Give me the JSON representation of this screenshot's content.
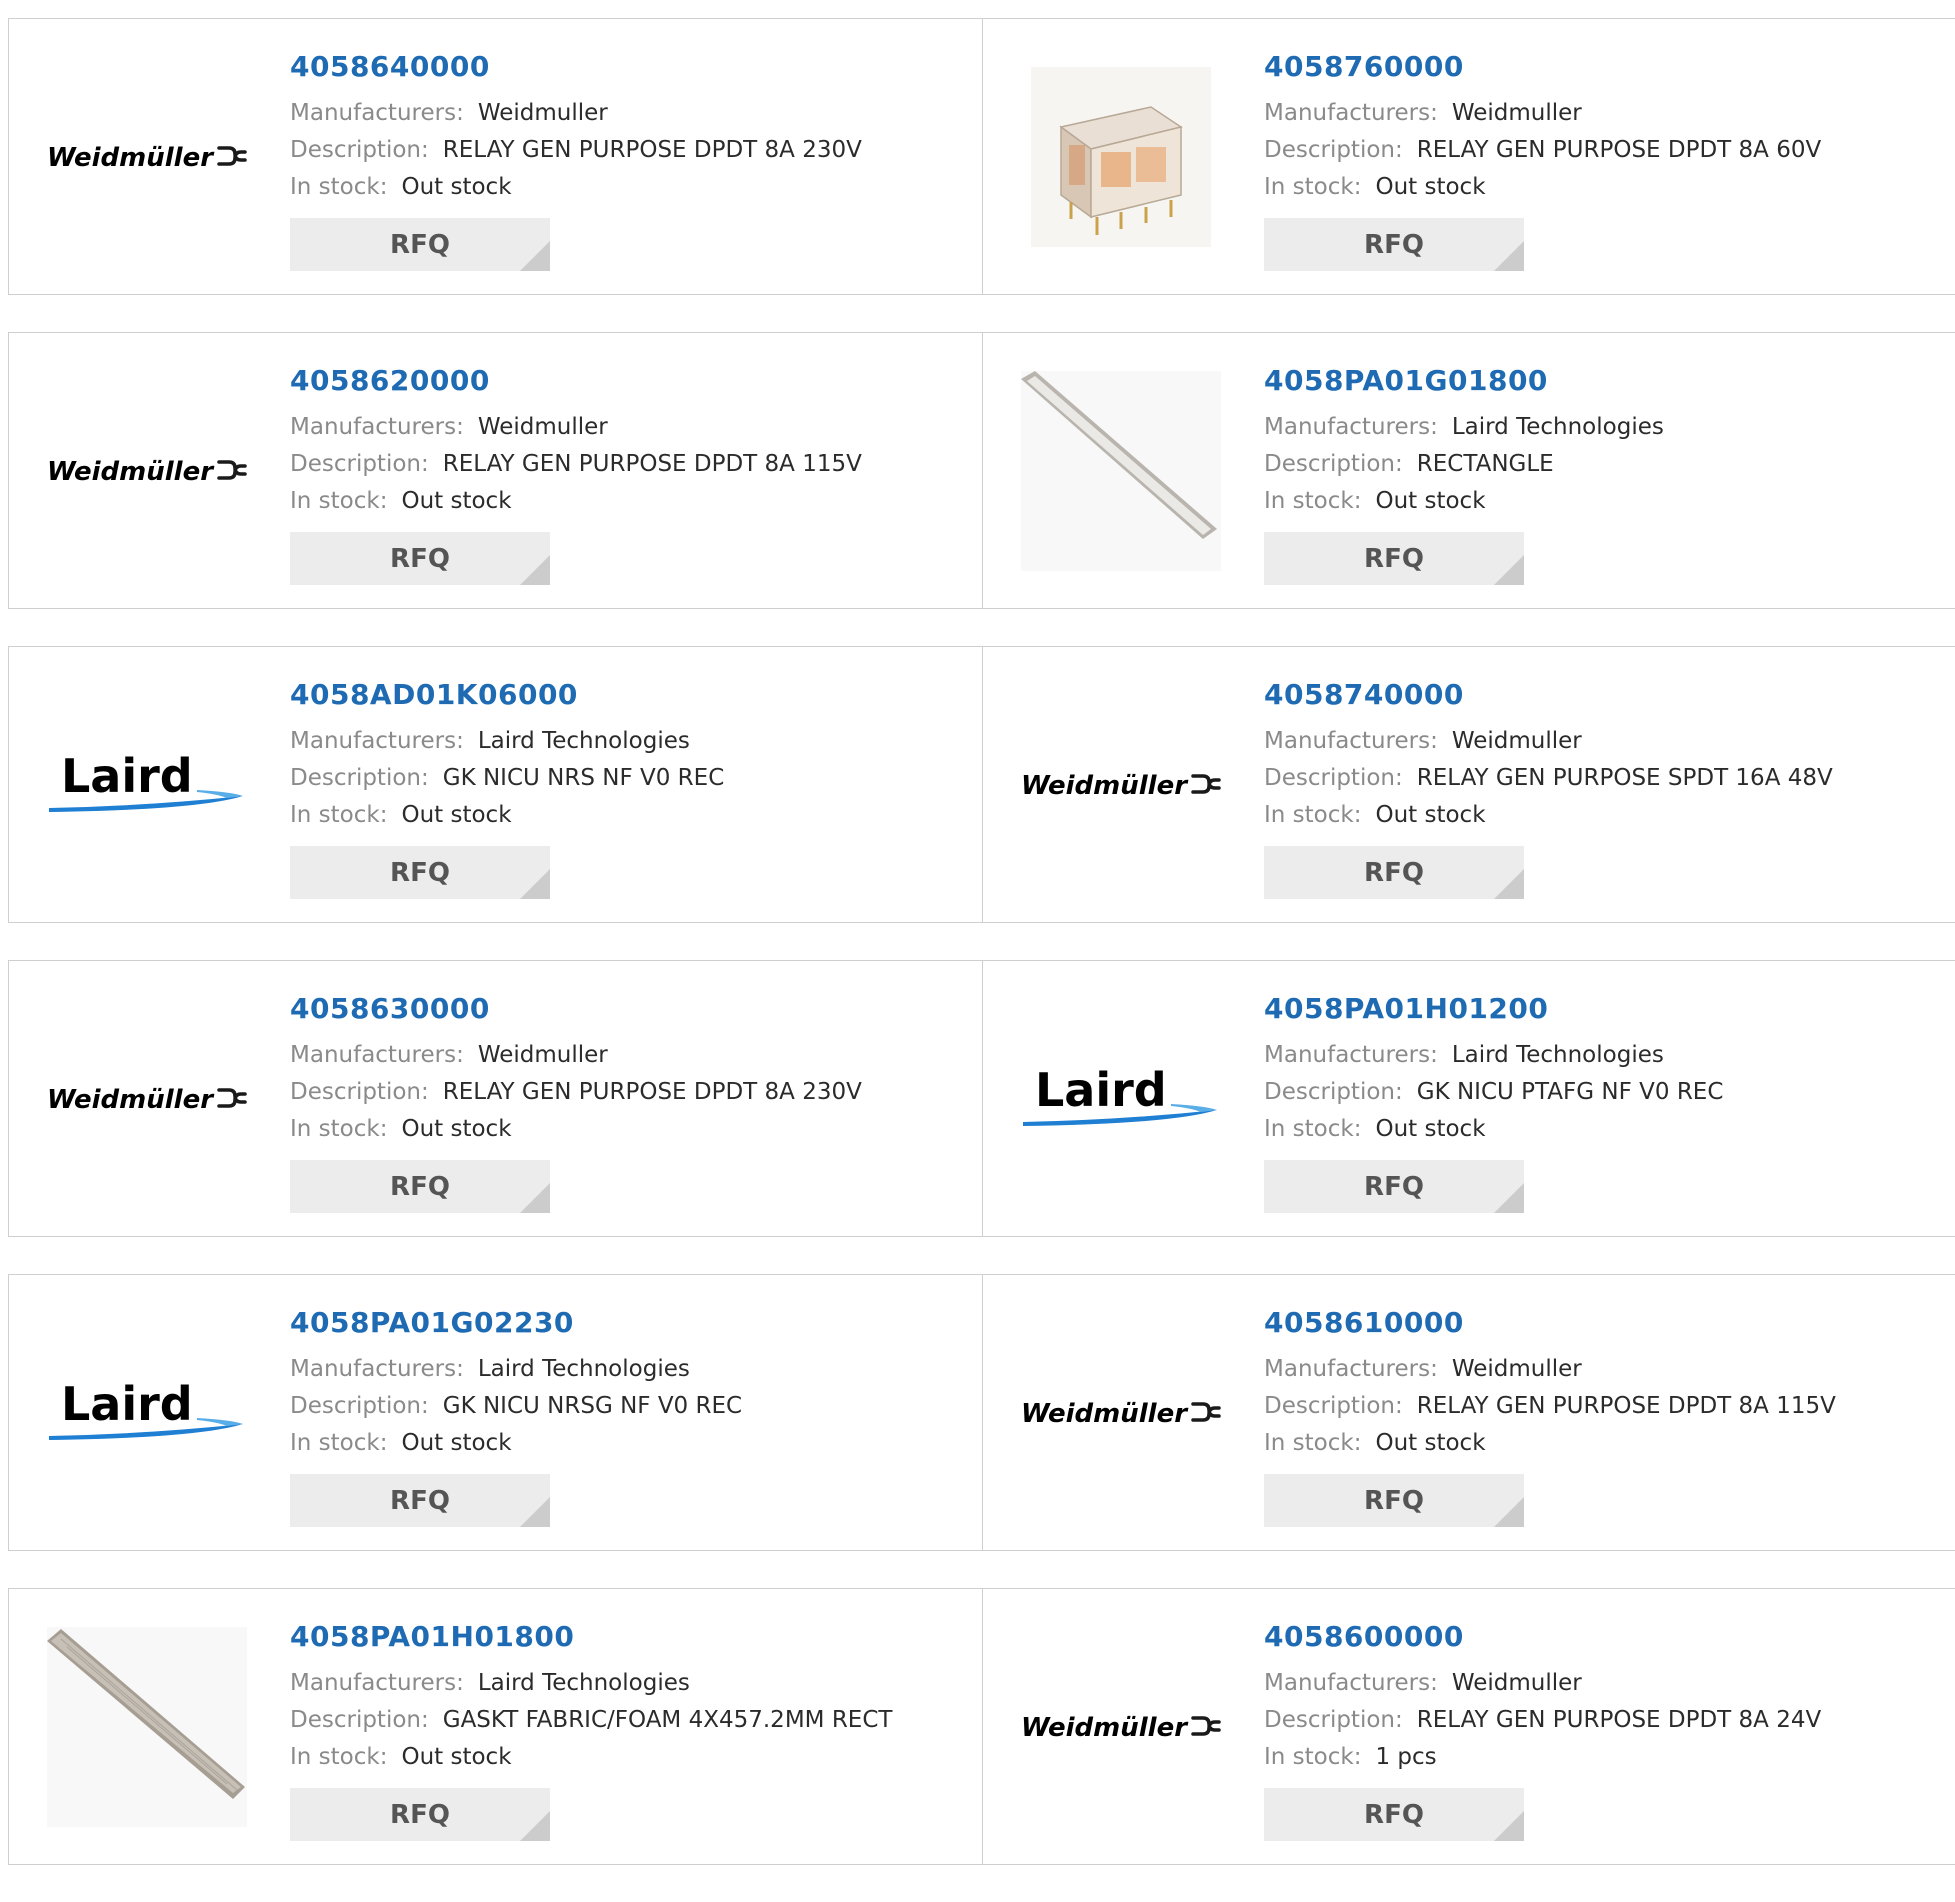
{
  "labels": {
    "manufacturers": "Manufacturers:",
    "description": "Description:",
    "in_stock": "In stock:",
    "rfq": "RFQ"
  },
  "logo_text": {
    "weidmuller": "Weidmüller",
    "laird": "Laird"
  },
  "colors": {
    "part_link": "#1f6bb3",
    "weidmuller_orange": "#f39a1e",
    "laird_blue": "#1f7fd3"
  },
  "products": [
    {
      "part": "4058640000",
      "manufacturer": "Weidmuller",
      "description": "RELAY GEN PURPOSE DPDT 8A 230V",
      "stock": "Out stock",
      "image": "weidmuller-logo"
    },
    {
      "part": "4058760000",
      "manufacturer": "Weidmuller",
      "description": "RELAY GEN PURPOSE DPDT 8A 60V",
      "stock": "Out stock",
      "image": "relay-photo"
    },
    {
      "part": "4058620000",
      "manufacturer": "Weidmuller",
      "description": "RELAY GEN PURPOSE DPDT 8A 115V",
      "stock": "Out stock",
      "image": "weidmuller-logo"
    },
    {
      "part": "4058PA01G01800",
      "manufacturer": "Laird Technologies",
      "description": "RECTANGLE",
      "stock": "Out stock",
      "image": "gasket-strip-photo"
    },
    {
      "part": "4058AD01K06000",
      "manufacturer": "Laird Technologies",
      "description": "GK NICU NRS NF V0 REC",
      "stock": "Out stock",
      "image": "laird-logo"
    },
    {
      "part": "4058740000",
      "manufacturer": "Weidmuller",
      "description": "RELAY GEN PURPOSE SPDT 16A 48V",
      "stock": "Out stock",
      "image": "weidmuller-logo"
    },
    {
      "part": "4058630000",
      "manufacturer": "Weidmuller",
      "description": "RELAY GEN PURPOSE DPDT 8A 230V",
      "stock": "Out stock",
      "image": "weidmuller-logo"
    },
    {
      "part": "4058PA01H01200",
      "manufacturer": "Laird Technologies",
      "description": "GK NICU PTAFG NF V0 REC",
      "stock": "Out stock",
      "image": "laird-logo"
    },
    {
      "part": "4058PA01G02230",
      "manufacturer": "Laird Technologies",
      "description": "GK NICU NRSG NF V0 REC",
      "stock": "Out stock",
      "image": "laird-logo"
    },
    {
      "part": "4058610000",
      "manufacturer": "Weidmuller",
      "description": "RELAY GEN PURPOSE DPDT 8A 115V",
      "stock": "Out stock",
      "image": "weidmuller-logo"
    },
    {
      "part": "4058PA01H01800",
      "manufacturer": "Laird Technologies",
      "description": "GASKT FABRIC/FOAM 4X457.2MM RECT",
      "stock": "Out stock",
      "image": "fabric-gasket-photo"
    },
    {
      "part": "4058600000",
      "manufacturer": "Weidmuller",
      "description": "RELAY GEN PURPOSE DPDT 8A 24V",
      "stock": "1 pcs",
      "image": "weidmuller-logo"
    }
  ]
}
